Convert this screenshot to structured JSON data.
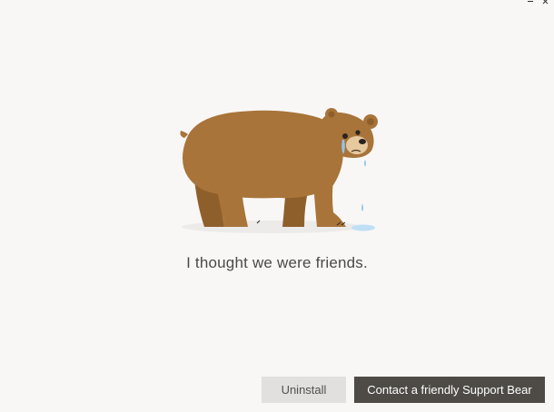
{
  "window": {
    "controls": [
      "minimize",
      "close"
    ]
  },
  "illustration": {
    "icon": "crying-bear-illustration",
    "colors": {
      "fur": "#a8743a",
      "fur_shadow": "#8f5f2b",
      "muzzle": "#e7c9a0",
      "tear": "#8fc6e8",
      "shadow": "#ecebea"
    }
  },
  "message": "I thought we were friends.",
  "actions": {
    "uninstall_label": "Uninstall",
    "contact_label": "Contact a friendly Support Bear"
  }
}
